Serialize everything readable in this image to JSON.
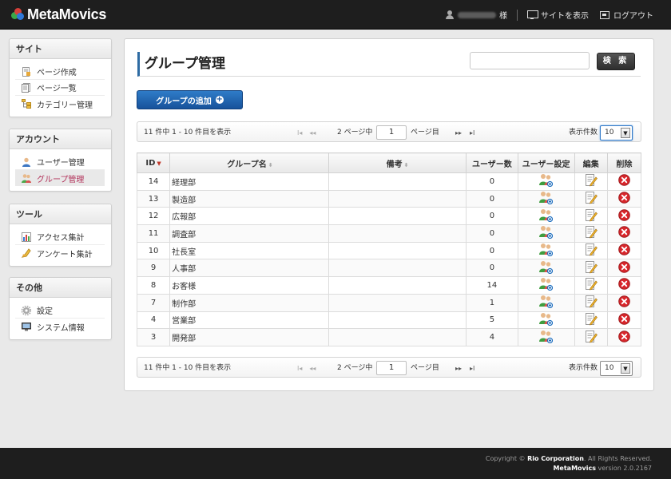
{
  "app": {
    "name": "MetaMovics"
  },
  "header": {
    "user_suffix": "様",
    "view_site": "サイトを表示",
    "logout": "ログアウト"
  },
  "sidebar": {
    "sections": [
      {
        "title": "サイト",
        "items": [
          {
            "label": "ページ作成",
            "icon": "page-create-icon"
          },
          {
            "label": "ページ一覧",
            "icon": "page-list-icon"
          },
          {
            "label": "カテゴリー管理",
            "icon": "category-icon"
          }
        ]
      },
      {
        "title": "アカウント",
        "items": [
          {
            "label": "ユーザー管理",
            "icon": "user-icon"
          },
          {
            "label": "グループ管理",
            "icon": "group-icon",
            "active": true
          }
        ]
      },
      {
        "title": "ツール",
        "items": [
          {
            "label": "アクセス集計",
            "icon": "bar-chart-icon"
          },
          {
            "label": "アンケート集計",
            "icon": "survey-icon"
          }
        ]
      },
      {
        "title": "その他",
        "items": [
          {
            "label": "設定",
            "icon": "gear-icon"
          },
          {
            "label": "システム情報",
            "icon": "system-info-icon"
          }
        ]
      }
    ]
  },
  "main": {
    "title": "グループ管理",
    "search_value": "",
    "search_button": "検 索",
    "add_button": "グループの追加",
    "pager": {
      "info": "11 件中 1 - 10 件目を表示",
      "page_prefix": "2 ページ中",
      "page_value": "1",
      "page_suffix": "ページ目",
      "count_label": "表示件数",
      "count_value": "10",
      "first_glyph": "I◂",
      "prev_glyph": "◂◂",
      "next_glyph": "▸▸",
      "last_glyph": "▸I",
      "arrow_glyph": "▼"
    },
    "table": {
      "headers": {
        "id": "ID",
        "name": "グループ名",
        "note": "備考",
        "users": "ユーザー数",
        "user_settings": "ユーザー設定",
        "edit": "編集",
        "delete": "削除"
      },
      "rows": [
        {
          "id": "14",
          "name": "経理部",
          "note": "",
          "users": "0"
        },
        {
          "id": "13",
          "name": "製造部",
          "note": "",
          "users": "0"
        },
        {
          "id": "12",
          "name": "広報部",
          "note": "",
          "users": "0"
        },
        {
          "id": "11",
          "name": "調査部",
          "note": "",
          "users": "0"
        },
        {
          "id": "10",
          "name": "社長室",
          "note": "",
          "users": "0"
        },
        {
          "id": "9",
          "name": "人事部",
          "note": "",
          "users": "0"
        },
        {
          "id": "8",
          "name": "お客様",
          "note": "",
          "users": "14"
        },
        {
          "id": "7",
          "name": "制作部",
          "note": "",
          "users": "1"
        },
        {
          "id": "4",
          "name": "営業部",
          "note": "",
          "users": "5"
        },
        {
          "id": "3",
          "name": "開発部",
          "note": "",
          "users": "4"
        }
      ]
    }
  },
  "footer": {
    "copyright_prefix": "Copyright © ",
    "company": "Rio Corporation",
    "copyright_suffix": ". All Rights Reserved.",
    "version_app": "MetaMovics",
    "version_text": " version 2.0.2167"
  },
  "colors": {
    "accent": "#2e6ba3",
    "active_item": "#b2325a",
    "delete_red": "#d8262b"
  }
}
